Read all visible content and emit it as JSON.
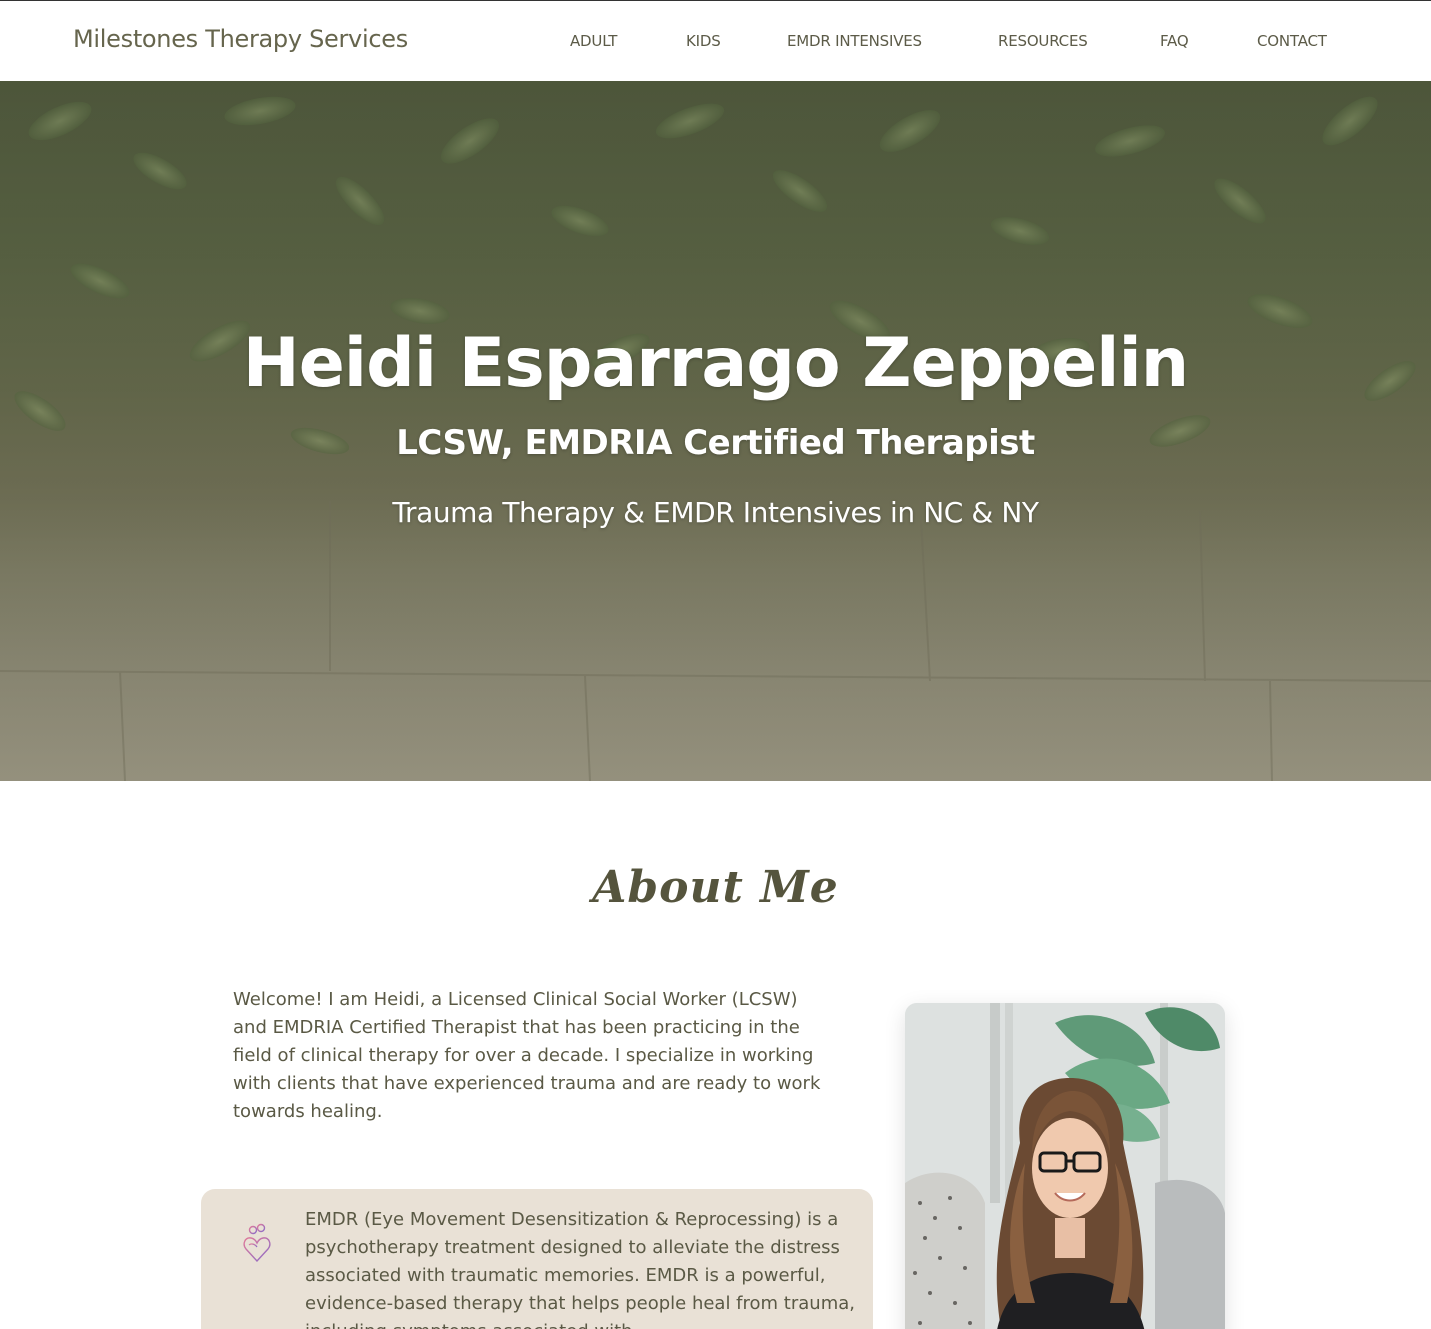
{
  "header": {
    "brand": "Milestones Therapy Services",
    "nav": [
      {
        "label": "ADULT"
      },
      {
        "label": "KIDS"
      },
      {
        "label": "EMDR INTENSIVES"
      },
      {
        "label": "RESOURCES"
      },
      {
        "label": "FAQ"
      },
      {
        "label": "CONTACT"
      }
    ]
  },
  "hero": {
    "name": "Heidi Esparrago Zeppelin",
    "credentials": "LCSW, EMDRIA Certified Therapist",
    "tagline": "Trauma Therapy & EMDR Intensives in NC & NY"
  },
  "about": {
    "title": "About Me",
    "intro": "Welcome! I am Heidi, a Licensed Clinical Social Worker (LCSW) and EMDRIA Certified Therapist that has been practicing in the field of clinical therapy for over a decade. I specialize in working with clients that have experienced trauma and are ready to work towards healing.",
    "emdr_text": "EMDR (Eye Movement Desensitization & Reprocessing) is a psychotherapy treatment designed to alleviate the distress associated with traumatic memories. EMDR is a powerful, evidence-based therapy that helps people heal from trauma, including symptoms associated with",
    "emdr_icon": "people-heart-icon",
    "portrait_icon": "therapist-portrait"
  },
  "colors": {
    "text": "#5a5945",
    "card_bg": "#e9e1d6",
    "hero_overlay": "#5b6746"
  }
}
